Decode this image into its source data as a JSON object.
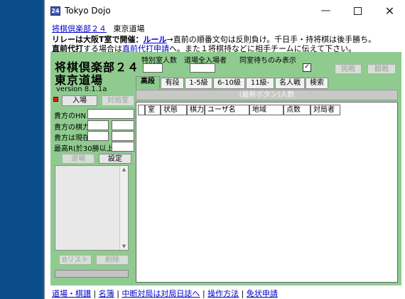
{
  "window": {
    "title": "Tokyo Dojo",
    "controls": {
      "minimize": "—",
      "close": "✕"
    }
  },
  "header": {
    "line1": {
      "link": "将棋倶楽部２４",
      "text": "東京道場"
    },
    "line2": {
      "lead": "リレーは大阪T室で開催：",
      "link": "ルール",
      "rest": "→直前の順番文句は反則負け。千日手・持将棋は後手勝ち。"
    },
    "line3": {
      "lead": "直前代打",
      "mid": "する場合は",
      "link": "直前代打申請",
      "rest": "へ。また１将棋持などに相手チームに伝えて下さい。"
    }
  },
  "left": {
    "title_line1": "将棋倶楽部２４",
    "title_line2": "東京道場",
    "version": "version 8.1.1a",
    "enter_button": "入場",
    "recon_button": "対局室",
    "fields": {
      "hn_label": "貴方のHN",
      "rating_label": "貴方の棋力",
      "status_label": "貴方は現在",
      "max_label": "最高R(於30勝以上)"
    },
    "leave_button": "退場",
    "settings_button": "設定",
    "block_list_button": "Bリスト",
    "delete_button": "削除"
  },
  "top_area": {
    "special_room_label": "特別室人数",
    "dojo_total_label": "道場全入場者",
    "same_room_label": "同室待ちのみ表示",
    "same_room_checked": "✓",
    "challenge_button": "挑戦",
    "watch_button": "観戦"
  },
  "tabs": [
    {
      "label": "高段",
      "active": true
    },
    {
      "label": "有段"
    },
    {
      "label": "1-5級"
    },
    {
      "label": "6-10級"
    },
    {
      "label": "11級-"
    },
    {
      "label": "名人戦"
    },
    {
      "label": "検索"
    }
  ],
  "banner": "(最新ボタン)人数",
  "table": {
    "columns": [
      "",
      "室",
      "状態",
      "棋力",
      "ユーザ名",
      "地域",
      "点数",
      "対局者"
    ]
  },
  "footer": {
    "links": [
      "道場・棋譜",
      "名簿",
      "中断対局は対局日誌へ",
      "操作方法",
      "免状申請"
    ],
    "separator": "|"
  }
}
